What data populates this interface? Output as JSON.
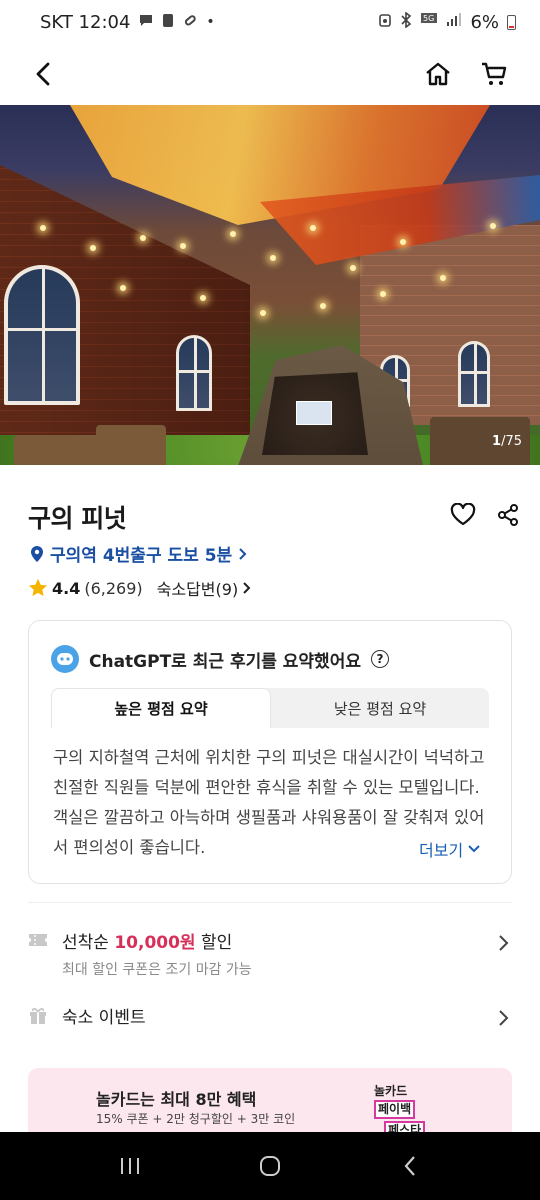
{
  "status_bar": {
    "carrier_time": "SKT 12:04",
    "icons_left": [
      "chat-bubble-icon",
      "sim-icon",
      "link-icon",
      "dot-icon"
    ],
    "icons_right": [
      "alarm-icon",
      "bluetooth-icon",
      "5g-icon",
      "signal-icon"
    ],
    "battery": "6%"
  },
  "header": {
    "back_icon": "back-arrow-icon",
    "home_icon": "home-icon",
    "cart_icon": "cart-icon"
  },
  "gallery": {
    "current": "1",
    "separator": "/",
    "total": "75"
  },
  "property": {
    "title": "구의 피넛",
    "location": "구의역 4번출구 도보 5분",
    "rating": "4.4",
    "review_count": "(6,269)",
    "owner_replies": "숙소답변(9)"
  },
  "ai_summary": {
    "title": "ChatGPT로 최근 후기를 요약했어요",
    "help": "?",
    "tabs": [
      "높은 평점 요약",
      "낮은 평점 요약"
    ],
    "active_tab": 0,
    "text": "구의 지하철역 근처에 위치한 구의 피넛은 대실시간이 넉넉하고 친절한 직원들 덕분에 편안한 휴식을 취할 수 있는 모텔입니다. 객실은 깔끔하고 아늑하며 생필품과 샤워용품이 잘 갖춰져 있어서 편의성이 좋습니다.",
    "more": "더보기"
  },
  "coupon": {
    "prefix": "선착순 ",
    "amount": "10,000원",
    "suffix": " 할인",
    "sub": "최대 할인 쿠폰은 조기 마감 가능"
  },
  "event": {
    "label": "숙소 이벤트"
  },
  "banner": {
    "title": "놀카드는 최대 8만 혜택",
    "sub": "15% 쿠폰 + 2만 청구할인 + 3만 코인",
    "logo_line1": "놀카드",
    "logo_line2": "페이백",
    "logo_line3": "페스타"
  },
  "colors": {
    "accent_blue": "#1a4fa3",
    "discount_red": "#d6305a",
    "star": "#f5b400",
    "banner_bg": "#fde7ee"
  }
}
